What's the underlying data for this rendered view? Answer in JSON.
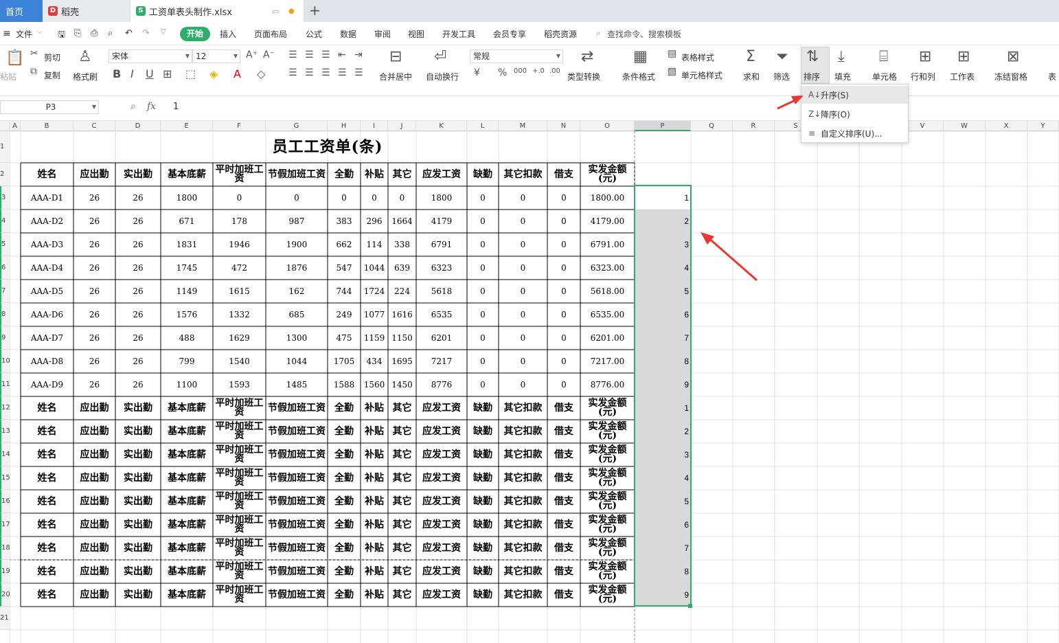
{
  "tabs": {
    "home": "首页",
    "daoke": "稻壳",
    "file": "工资单表头制作.xlsx"
  },
  "menu": {
    "file": "文件",
    "items": [
      "开始",
      "插入",
      "页面布局",
      "公式",
      "数据",
      "审阅",
      "视图",
      "开发工具",
      "会员专享",
      "稻壳资源"
    ],
    "search": "查找命令、搜索模板"
  },
  "ribbon": {
    "cut": "剪切",
    "copy": "复制",
    "paste": "粘贴",
    "format_painter": "格式刷",
    "font_name": "宋体",
    "font_size": "12",
    "merge": "合并居中",
    "wrap": "自动换行",
    "number_format": "常规",
    "convert": "类型转换",
    "cond_format": "条件格式",
    "table_style": "表格样式",
    "cell_style": "单元格样式",
    "sum": "求和",
    "filter": "筛选",
    "sort": "排序",
    "fill": "填充",
    "cells": "单元格",
    "rows_cols": "行和列",
    "worksheet": "工作表",
    "freeze": "冻结窗格",
    "table": "表"
  },
  "formula": {
    "name_box": "P3",
    "fx": "fx",
    "value": "1"
  },
  "columns": [
    "A",
    "B",
    "C",
    "D",
    "E",
    "F",
    "G",
    "H",
    "I",
    "J",
    "K",
    "L",
    "M",
    "N",
    "O",
    "P",
    "Q",
    "R",
    "S",
    "T",
    "U",
    "V",
    "W",
    "X",
    "Y"
  ],
  "rows": [
    "1",
    "2",
    "3",
    "4",
    "5",
    "6",
    "7",
    "8",
    "9",
    "10",
    "11",
    "12",
    "13",
    "14",
    "15",
    "16",
    "17",
    "18",
    "19",
    "20",
    "21"
  ],
  "sheet": {
    "title": "员工工资单(条)",
    "headers": [
      "姓名",
      "应出勤",
      "实出勤",
      "基本底薪",
      "平时加班工资",
      "节假加班工资",
      "全勤",
      "补贴",
      "其它",
      "应发工资",
      "缺勤",
      "其它扣款",
      "借支",
      "实发金额(元)"
    ],
    "data": [
      [
        "AAA-D1",
        "26",
        "26",
        "1800",
        "0",
        "0",
        "0",
        "0",
        "0",
        "1800",
        "0",
        "0",
        "0",
        "1800.00"
      ],
      [
        "AAA-D2",
        "26",
        "26",
        "671",
        "178",
        "987",
        "383",
        "296",
        "1664",
        "4179",
        "0",
        "0",
        "0",
        "4179.00"
      ],
      [
        "AAA-D3",
        "26",
        "26",
        "1831",
        "1946",
        "1900",
        "662",
        "114",
        "338",
        "6791",
        "0",
        "0",
        "0",
        "6791.00"
      ],
      [
        "AAA-D4",
        "26",
        "26",
        "1745",
        "472",
        "1876",
        "547",
        "1044",
        "639",
        "6323",
        "0",
        "0",
        "0",
        "6323.00"
      ],
      [
        "AAA-D5",
        "26",
        "26",
        "1149",
        "1615",
        "162",
        "744",
        "1724",
        "224",
        "5618",
        "0",
        "0",
        "0",
        "5618.00"
      ],
      [
        "AAA-D6",
        "26",
        "26",
        "1576",
        "1332",
        "685",
        "249",
        "1077",
        "1616",
        "6535",
        "0",
        "0",
        "0",
        "6535.00"
      ],
      [
        "AAA-D7",
        "26",
        "26",
        "488",
        "1629",
        "1300",
        "475",
        "1159",
        "1150",
        "6201",
        "0",
        "0",
        "0",
        "6201.00"
      ],
      [
        "AAA-D8",
        "26",
        "26",
        "799",
        "1540",
        "1044",
        "1705",
        "434",
        "1695",
        "7217",
        "0",
        "0",
        "0",
        "7217.00"
      ],
      [
        "AAA-D9",
        "26",
        "26",
        "1100",
        "1593",
        "1485",
        "1588",
        "1560",
        "1450",
        "8776",
        "0",
        "0",
        "0",
        "8776.00"
      ]
    ],
    "p_values": [
      "1",
      "2",
      "3",
      "4",
      "5",
      "6",
      "7",
      "8",
      "9",
      "1",
      "2",
      "3",
      "4",
      "5",
      "6",
      "7",
      "8",
      "9"
    ]
  },
  "dropdown": {
    "asc": "升序(S)",
    "desc": "降序(O)",
    "custom": "自定义排序(U)..."
  }
}
